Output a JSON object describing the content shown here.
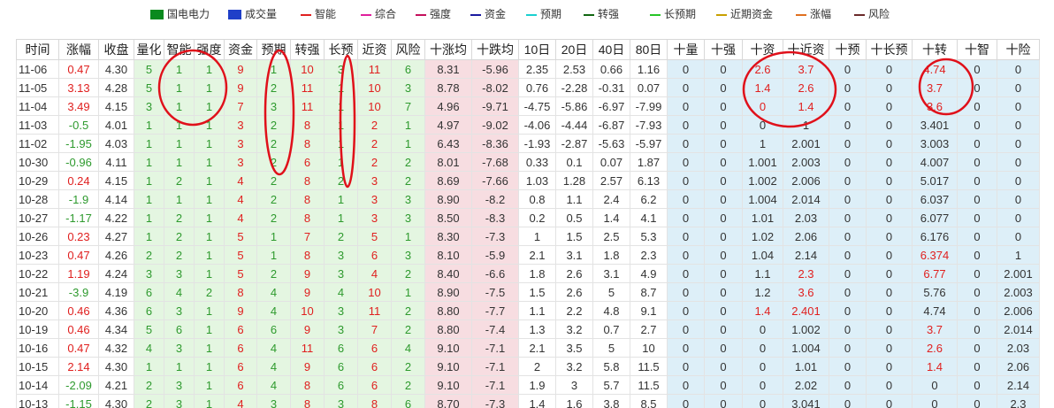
{
  "legend": [
    {
      "name": "国电电力",
      "color": "#0a8a1e",
      "shape": "box"
    },
    {
      "name": "成交量",
      "color": "#1f3fc8",
      "shape": "box"
    },
    {
      "name": "智能",
      "color": "#e02020",
      "shape": "line"
    },
    {
      "name": "综合",
      "color": "#e0209c",
      "shape": "line"
    },
    {
      "name": "强度",
      "color": "#c4105c",
      "shape": "line"
    },
    {
      "name": "资金",
      "color": "#1a1aa0",
      "shape": "line"
    },
    {
      "name": "预期",
      "color": "#1ad0d0",
      "shape": "line"
    },
    {
      "name": "转强",
      "color": "#116611",
      "shape": "line"
    },
    {
      "name": "长预期",
      "color": "#27c427",
      "shape": "line"
    },
    {
      "name": "近期资金",
      "color": "#c8a000",
      "shape": "line"
    },
    {
      "name": "涨幅",
      "color": "#e07020",
      "shape": "line"
    },
    {
      "name": "风险",
      "color": "#6a2a2a",
      "shape": "line"
    }
  ],
  "headers": [
    "时间",
    "涨幅",
    "收盘",
    "量化",
    "智能",
    "强度",
    "资金",
    "预期",
    "转强",
    "长预",
    "近资",
    "风险",
    "十涨均",
    "十跌均",
    "10日",
    "20日",
    "40日",
    "80日",
    "十量",
    "十强",
    "十资",
    "十近资",
    "十预",
    "十长预",
    "十转",
    "十智",
    "十险"
  ],
  "rows": [
    [
      "11-06",
      "0.47",
      "4.30",
      "5",
      "1",
      "1",
      "9",
      "1",
      "10",
      "3",
      "11",
      "6",
      "8.31",
      "-5.96",
      "2.35",
      "2.53",
      "0.66",
      "1.16",
      "0",
      "0",
      "2.6",
      "3.7",
      "0",
      "0",
      "4.74",
      "0",
      "0"
    ],
    [
      "11-05",
      "3.13",
      "4.28",
      "5",
      "1",
      "1",
      "9",
      "2",
      "11",
      "1",
      "10",
      "3",
      "8.78",
      "-8.02",
      "0.76",
      "-2.28",
      "-0.31",
      "0.07",
      "0",
      "0",
      "1.4",
      "2.6",
      "0",
      "0",
      "3.7",
      "0",
      "0"
    ],
    [
      "11-04",
      "3.49",
      "4.15",
      "3",
      "1",
      "1",
      "7",
      "3",
      "11",
      "1",
      "10",
      "7",
      "4.96",
      "-9.71",
      "-4.75",
      "-5.86",
      "-6.97",
      "-7.99",
      "0",
      "0",
      "0",
      "1.4",
      "0",
      "0",
      "3.6",
      "0",
      "0"
    ],
    [
      "11-03",
      "-0.5",
      "4.01",
      "1",
      "1",
      "1",
      "3",
      "2",
      "8",
      "1",
      "2",
      "1",
      "4.97",
      "-9.02",
      "-4.06",
      "-4.44",
      "-6.87",
      "-7.93",
      "0",
      "0",
      "0",
      "1",
      "0",
      "0",
      "3.401",
      "0",
      "0"
    ],
    [
      "11-02",
      "-1.95",
      "4.03",
      "1",
      "1",
      "1",
      "3",
      "2",
      "8",
      "1",
      "2",
      "1",
      "6.43",
      "-8.36",
      "-1.93",
      "-2.87",
      "-5.63",
      "-5.97",
      "0",
      "0",
      "1",
      "2.001",
      "0",
      "0",
      "3.003",
      "0",
      "0"
    ],
    [
      "10-30",
      "-0.96",
      "4.11",
      "1",
      "1",
      "1",
      "3",
      "2",
      "6",
      "1",
      "2",
      "2",
      "8.01",
      "-7.68",
      "0.33",
      "0.1",
      "0.07",
      "1.87",
      "0",
      "0",
      "1.001",
      "2.003",
      "0",
      "0",
      "4.007",
      "0",
      "0"
    ],
    [
      "10-29",
      "0.24",
      "4.15",
      "1",
      "2",
      "1",
      "4",
      "2",
      "8",
      "2",
      "3",
      "2",
      "8.69",
      "-7.66",
      "1.03",
      "1.28",
      "2.57",
      "6.13",
      "0",
      "0",
      "1.002",
      "2.006",
      "0",
      "0",
      "5.017",
      "0",
      "0"
    ],
    [
      "10-28",
      "-1.9",
      "4.14",
      "1",
      "1",
      "1",
      "4",
      "2",
      "8",
      "1",
      "3",
      "3",
      "8.90",
      "-8.2",
      "0.8",
      "1.1",
      "2.4",
      "6.2",
      "0",
      "0",
      "1.004",
      "2.014",
      "0",
      "0",
      "6.037",
      "0",
      "0"
    ],
    [
      "10-27",
      "-1.17",
      "4.22",
      "1",
      "2",
      "1",
      "4",
      "2",
      "8",
      "1",
      "3",
      "3",
      "8.50",
      "-8.3",
      "0.2",
      "0.5",
      "1.4",
      "4.1",
      "0",
      "0",
      "1.01",
      "2.03",
      "0",
      "0",
      "6.077",
      "0",
      "0"
    ],
    [
      "10-26",
      "0.23",
      "4.27",
      "1",
      "2",
      "1",
      "5",
      "1",
      "7",
      "2",
      "5",
      "1",
      "8.30",
      "-7.3",
      "1",
      "1.5",
      "2.5",
      "5.3",
      "0",
      "0",
      "1.02",
      "2.06",
      "0",
      "0",
      "6.176",
      "0",
      "0"
    ],
    [
      "10-23",
      "0.47",
      "4.26",
      "2",
      "2",
      "1",
      "5",
      "1",
      "8",
      "3",
      "6",
      "3",
      "8.10",
      "-5.9",
      "2.1",
      "3.1",
      "1.8",
      "2.3",
      "0",
      "0",
      "1.04",
      "2.14",
      "0",
      "0",
      "6.374",
      "0",
      "1"
    ],
    [
      "10-22",
      "1.19",
      "4.24",
      "3",
      "3",
      "1",
      "5",
      "2",
      "9",
      "3",
      "4",
      "2",
      "8.40",
      "-6.6",
      "1.8",
      "2.6",
      "3.1",
      "4.9",
      "0",
      "0",
      "1.1",
      "2.3",
      "0",
      "0",
      "6.77",
      "0",
      "2.001"
    ],
    [
      "10-21",
      "-3.9",
      "4.19",
      "6",
      "4",
      "2",
      "8",
      "4",
      "9",
      "4",
      "10",
      "1",
      "8.90",
      "-7.5",
      "1.5",
      "2.6",
      "5",
      "8.7",
      "0",
      "0",
      "1.2",
      "3.6",
      "0",
      "0",
      "5.76",
      "0",
      "2.003"
    ],
    [
      "10-20",
      "0.46",
      "4.36",
      "6",
      "3",
      "1",
      "9",
      "4",
      "10",
      "3",
      "11",
      "2",
      "8.80",
      "-7.7",
      "1.1",
      "2.2",
      "4.8",
      "9.1",
      "0",
      "0",
      "1.4",
      "2.401",
      "0",
      "0",
      "4.74",
      "0",
      "2.006"
    ],
    [
      "10-19",
      "0.46",
      "4.34",
      "5",
      "6",
      "1",
      "6",
      "6",
      "9",
      "3",
      "7",
      "2",
      "8.80",
      "-7.4",
      "1.3",
      "3.2",
      "0.7",
      "2.7",
      "0",
      "0",
      "0",
      "1.002",
      "0",
      "0",
      "3.7",
      "0",
      "2.014"
    ],
    [
      "10-16",
      "0.47",
      "4.32",
      "4",
      "3",
      "1",
      "6",
      "4",
      "11",
      "6",
      "6",
      "4",
      "9.10",
      "-7.1",
      "2.1",
      "3.5",
      "5",
      "10",
      "0",
      "0",
      "0",
      "1.004",
      "0",
      "0",
      "2.6",
      "0",
      "2.03"
    ],
    [
      "10-15",
      "2.14",
      "4.30",
      "1",
      "1",
      "1",
      "6",
      "4",
      "9",
      "6",
      "6",
      "2",
      "9.10",
      "-7.1",
      "2",
      "3.2",
      "5.8",
      "11.5",
      "0",
      "0",
      "0",
      "1.01",
      "0",
      "0",
      "1.4",
      "0",
      "2.06"
    ],
    [
      "10-14",
      "-2.09",
      "4.21",
      "2",
      "3",
      "1",
      "6",
      "4",
      "8",
      "6",
      "6",
      "2",
      "9.10",
      "-7.1",
      "1.9",
      "3",
      "5.7",
      "11.5",
      "0",
      "0",
      "0",
      "2.02",
      "0",
      "0",
      "0",
      "0",
      "2.14"
    ],
    [
      "10-13",
      "-1.15",
      "4.30",
      "2",
      "3",
      "1",
      "4",
      "3",
      "8",
      "3",
      "8",
      "6",
      "8.70",
      "-7.3",
      "1.4",
      "1.6",
      "3.8",
      "8.5",
      "0",
      "0",
      "0",
      "3.041",
      "0",
      "0",
      "0",
      "0",
      "2.3"
    ]
  ],
  "colors": {
    "red": "#e0201f",
    "green": "#2e9a2e",
    "green_bg": "#e4f6e1",
    "pink_bg": "#f7dde1",
    "blue_bg": "#ddeff8",
    "annotation": "#e0101a"
  }
}
